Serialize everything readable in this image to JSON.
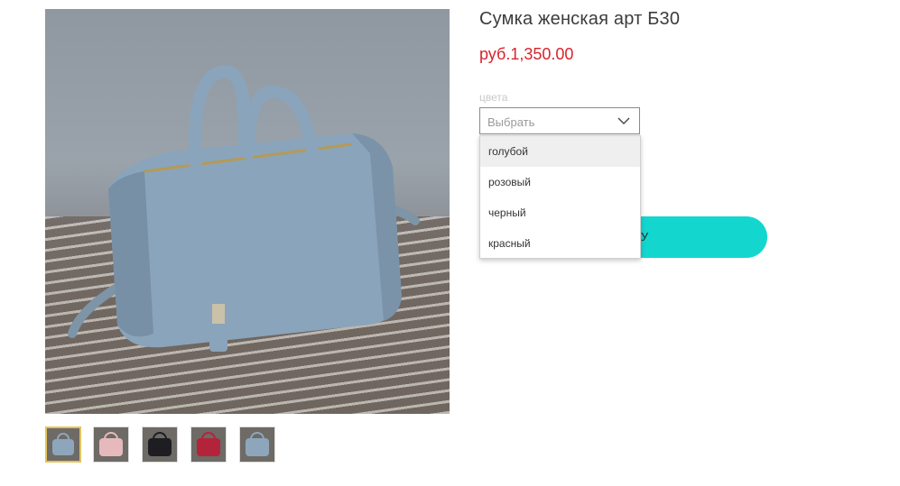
{
  "product": {
    "title": "Сумка женская арт Б30",
    "price": "руб.1,350.00"
  },
  "gallery": {
    "zoom_icon": "magnifier-icon",
    "thumbnails": [
      {
        "color": "#8ea6bb",
        "active": true
      },
      {
        "color": "#e6b9bd",
        "active": false
      },
      {
        "color": "#1e1e22",
        "active": false
      },
      {
        "color": "#b3243a",
        "active": false
      },
      {
        "color": "#8ea6bb",
        "active": false
      }
    ]
  },
  "options": {
    "label": "цвета",
    "select_value": "Выбрать",
    "chevron_icon": "chevron-down-icon",
    "items": [
      "голубой",
      "розовый",
      "черный",
      "красный"
    ]
  },
  "cart": {
    "button_label_visible": "ОРЗИНУ"
  },
  "colors": {
    "price": "#d9232d",
    "accent": "#13d7cf",
    "active_thumb_border": "#e2c35a"
  }
}
